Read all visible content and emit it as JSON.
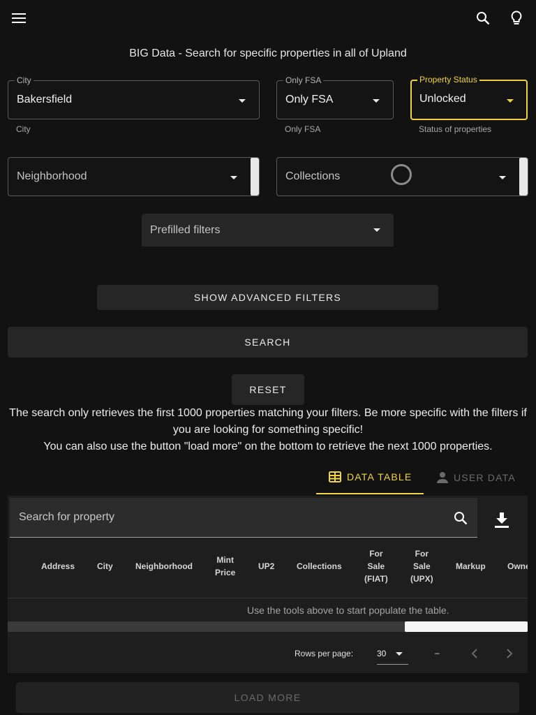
{
  "header": {
    "menu_icon": "hamburger-menu-icon",
    "search_icon": "search-icon",
    "theme_icon": "lightbulb-icon"
  },
  "title": "BIG Data - Search for specific properties in all of Upland",
  "filters": {
    "city": {
      "label": "City",
      "value": "Bakersfield",
      "helper": "City"
    },
    "only_fsa": {
      "label": "Only FSA",
      "value": "Only FSA",
      "helper": "Only FSA"
    },
    "property_status": {
      "label": "Property Status",
      "value": "Unlocked",
      "helper": "Status of properties"
    },
    "neighborhood": {
      "placeholder": "Neighborhood"
    },
    "collections": {
      "placeholder": "Collections"
    },
    "prefilled": {
      "placeholder": "Prefilled filters"
    }
  },
  "buttons": {
    "advanced": "SHOW ADVANCED FILTERS",
    "search": "SEARCH",
    "reset": "RESET",
    "load_more": "LOAD MORE"
  },
  "info": {
    "line1": "The search only retrieves the first 1000 properties matching your filters. Be more specific with the filters if",
    "line2": "you are looking for something specific!",
    "line3": "You can also use the button \"load more\" on the bottom to retrieve the next 1000 properties."
  },
  "tabs": [
    {
      "label": "DATA TABLE",
      "icon": "table-icon",
      "active": true
    },
    {
      "label": "USER DATA",
      "icon": "person-icon",
      "active": false
    }
  ],
  "table": {
    "search_placeholder": "Search for property",
    "columns": [
      {
        "lines": [
          "Address"
        ]
      },
      {
        "lines": [
          "City"
        ]
      },
      {
        "lines": [
          "Neighborhood"
        ]
      },
      {
        "lines": [
          "Mint",
          "Price"
        ]
      },
      {
        "lines": [
          "UP2"
        ]
      },
      {
        "lines": [
          "Collections"
        ]
      },
      {
        "lines": [
          "For",
          "Sale",
          "(FIAT)"
        ]
      },
      {
        "lines": [
          "For",
          "Sale",
          "(UPX)"
        ]
      },
      {
        "lines": [
          "Markup"
        ]
      },
      {
        "lines": [
          "Owne"
        ]
      }
    ],
    "empty_message": "Use the tools above to start populate the table.",
    "rows_per_page_label": "Rows per page:",
    "rows_per_page_value": "30",
    "range": "–"
  },
  "colors": {
    "accent": "#f2d343",
    "background": "#121212",
    "surface": "#262626"
  }
}
